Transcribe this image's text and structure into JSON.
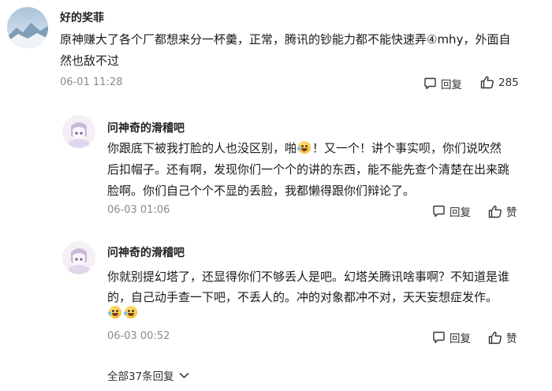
{
  "top_comment": {
    "username": "好的奖菲",
    "text_line1": "原神赚大了各个厂都想来分一杯羹，正常，腾讯的钞能力都不能快速弄④mhy，外面自",
    "text_line2": "然也敌不过",
    "time": "06-01 11:28",
    "reply_label": "回复",
    "like_count": "285"
  },
  "replies": [
    {
      "username": "问神奇的滑稽吧",
      "line1_before_emoji": "你跟底下被我打脸的人也没区别，啪",
      "line1_after_emoji": "！又一个！讲个事实呗，你们说吹然",
      "line2": "后扣帽子。还有啊，发现你们一个个的讲的东西，能不能先查个清楚在出来跳",
      "line3": "脸啊。你们自己个个不显的丢脸，我都懒得跟你们辩论了。",
      "time": "06-03 01:06",
      "reply_label": "回复",
      "like_label": "赞"
    },
    {
      "username": "问神奇的滑稽吧",
      "line1": "你就别提幻塔了，还显得你们不够丢人是吧。幻塔关腾讯啥事啊？不知道是谁",
      "line2": "的，自己动手查一下吧，不丢人的。冲的对象都冲不对，天天妄想症发作。",
      "time": "06-03 00:52",
      "reply_label": "回复",
      "like_label": "赞"
    }
  ],
  "more_replies_label": "全部37条回复",
  "colors": {
    "text": "#1a1a1a",
    "meta": "#8a8a8a",
    "action": "#333333"
  },
  "icons": {
    "reply": "comment-bubble-icon",
    "like": "thumbs-up-icon",
    "expand": "chevron-down-icon"
  }
}
